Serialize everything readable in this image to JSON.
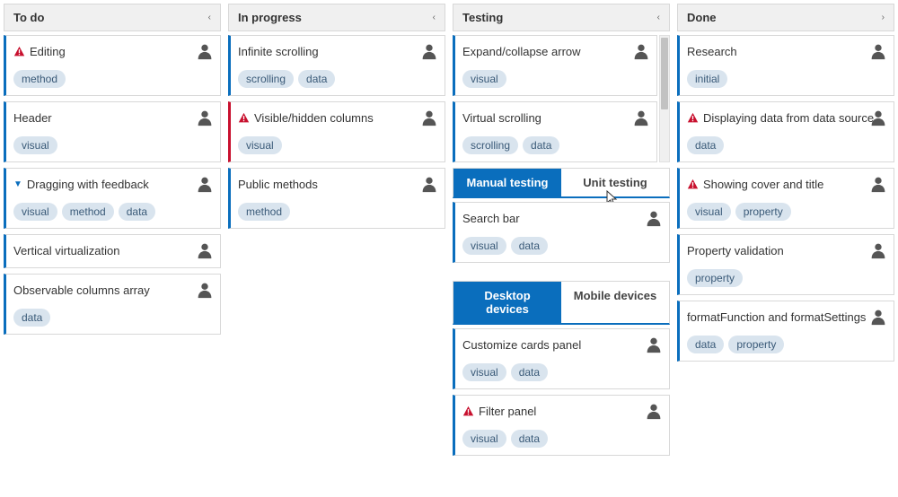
{
  "columns": {
    "todo": {
      "title": "To do",
      "chevron": "‹"
    },
    "inprogress": {
      "title": "In progress",
      "chevron": "‹"
    },
    "testing": {
      "title": "Testing",
      "chevron": "‹"
    },
    "done": {
      "title": "Done",
      "chevron": "›"
    }
  },
  "tabs": {
    "testing1": {
      "active": "Manual testing",
      "inactive": "Unit testing"
    },
    "testing2": {
      "active": "Desktop devices",
      "inactive": "Mobile devices"
    }
  },
  "cards": {
    "todo": [
      {
        "title": "Editing",
        "warn": true,
        "tags": [
          "method"
        ]
      },
      {
        "title": "Header",
        "tags": [
          "visual"
        ]
      },
      {
        "title": "Dragging with feedback",
        "caret": true,
        "tags": [
          "visual",
          "method",
          "data"
        ]
      },
      {
        "title": "Vertical virtualization",
        "tags": []
      },
      {
        "title": "Observable columns array",
        "tags": [
          "data"
        ]
      }
    ],
    "inprogress": [
      {
        "title": "Infinite scrolling",
        "tags": [
          "scrolling",
          "data"
        ]
      },
      {
        "title": "Visible/hidden columns",
        "warn": true,
        "redAccent": true,
        "tags": [
          "visual"
        ]
      },
      {
        "title": "Public methods",
        "tags": [
          "method"
        ]
      }
    ],
    "testing_top": [
      {
        "title": "Expand/collapse arrow",
        "tags": [
          "visual"
        ]
      },
      {
        "title": "Virtual scrolling",
        "tags": [
          "scrolling",
          "data"
        ]
      }
    ],
    "testing_mid": [
      {
        "title": "Search bar",
        "tags": [
          "visual",
          "data"
        ]
      }
    ],
    "testing_bot": [
      {
        "title": "Customize cards panel",
        "tags": [
          "visual",
          "data"
        ]
      },
      {
        "title": "Filter panel",
        "warn": true,
        "tags": [
          "visual",
          "data"
        ]
      }
    ],
    "done": [
      {
        "title": "Research",
        "tags": [
          "initial"
        ]
      },
      {
        "title": "Displaying data from data source",
        "warn": true,
        "tags": [
          "data"
        ]
      },
      {
        "title": "Showing cover and title",
        "warn": true,
        "tags": [
          "visual",
          "property"
        ]
      },
      {
        "title": "Property validation",
        "tags": [
          "property"
        ]
      },
      {
        "title": "formatFunction and formatSettings",
        "tags": [
          "data",
          "property"
        ]
      }
    ]
  }
}
